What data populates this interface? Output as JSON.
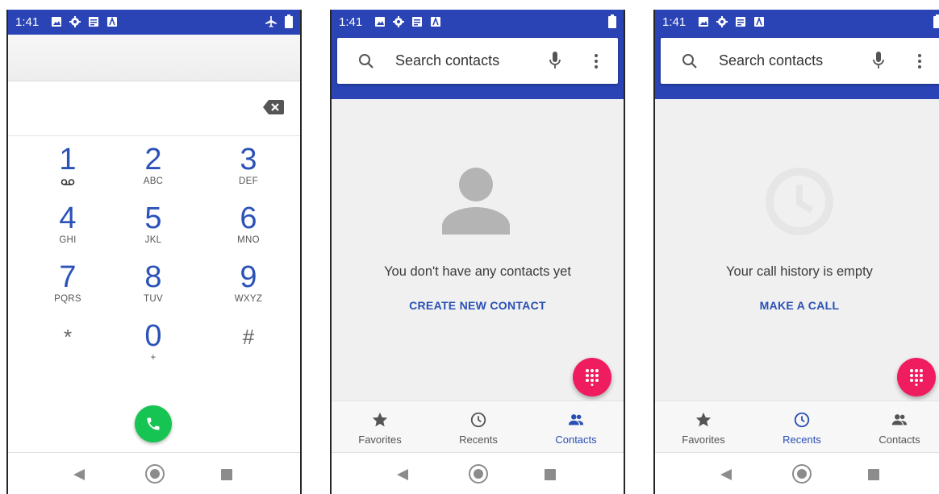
{
  "status": {
    "time": "1:41"
  },
  "dialer": {
    "keys": [
      {
        "digit": "1",
        "letters": ""
      },
      {
        "digit": "2",
        "letters": "ABC"
      },
      {
        "digit": "3",
        "letters": "DEF"
      },
      {
        "digit": "4",
        "letters": "GHI"
      },
      {
        "digit": "5",
        "letters": "JKL"
      },
      {
        "digit": "6",
        "letters": "MNO"
      },
      {
        "digit": "7",
        "letters": "PQRS"
      },
      {
        "digit": "8",
        "letters": "TUV"
      },
      {
        "digit": "9",
        "letters": "WXYZ"
      },
      {
        "digit": "*",
        "letters": ""
      },
      {
        "digit": "0",
        "letters": "+"
      },
      {
        "digit": "#",
        "letters": ""
      }
    ]
  },
  "contacts_screen": {
    "search_placeholder": "Search contacts",
    "empty_message": "You don't have any contacts yet",
    "empty_action": "CREATE NEW CONTACT"
  },
  "recents_screen": {
    "search_placeholder": "Search contacts",
    "empty_message": "Your call history is empty",
    "empty_action": "MAKE A CALL"
  },
  "tabs": {
    "favorites": "Favorites",
    "recents": "Recents",
    "contacts": "Contacts"
  },
  "colors": {
    "primary": "#2a44b6",
    "accent_text": "#2a4fb5",
    "fab": "#ef1c60",
    "call": "#16c453"
  }
}
